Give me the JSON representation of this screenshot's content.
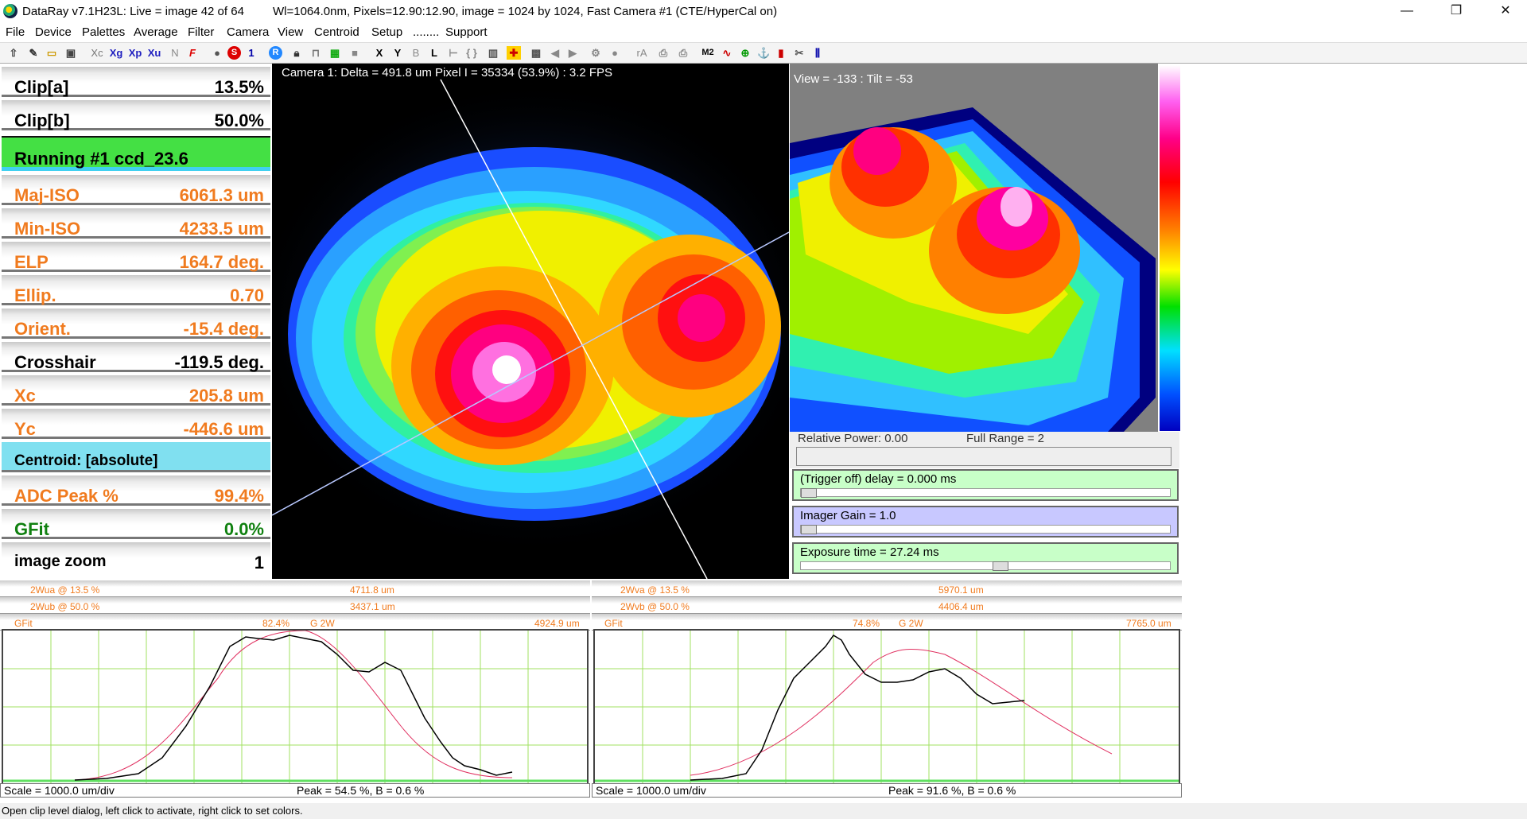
{
  "window": {
    "title": "DataRay v7.1H23L: Live = image 42 of 64",
    "info": "Wl=1064.0nm, Pixels=12.90:12.90, image = 1024 by 1024, Fast   Camera #1  (CTE/HyperCal on)",
    "minimize": "—",
    "restore": "❐",
    "close": "✕"
  },
  "menu": [
    "File",
    "Device",
    "Palettes",
    "Average",
    "Filter",
    "Camera",
    "View",
    "Centroid",
    "Setup",
    "........",
    "Support"
  ],
  "toolbar": {
    "xc": "Xc",
    "xg": "Xg",
    "xp": "Xp",
    "xu": "Xu",
    "n": "N",
    "f": "F",
    "s": "S",
    "one": "1",
    "r": "R",
    "x": "X",
    "y": "Y",
    "b": "B",
    "l": "L",
    "ra": "rA",
    "m2": "M2"
  },
  "results": [
    {
      "label": "Clip[a]",
      "value": "13.5%",
      "style": "black"
    },
    {
      "label": "Clip[b]",
      "value": "50.0%",
      "style": "black"
    },
    {
      "label": "Running #1 ccd_23.6",
      "value": "",
      "style": "run"
    },
    {
      "label": "Maj-ISO",
      "value": "6061.3 um",
      "style": "orange"
    },
    {
      "label": "Min-ISO",
      "value": "4233.5 um",
      "style": "orange"
    },
    {
      "label": "ELP",
      "value": "164.7 deg.",
      "style": "orange"
    },
    {
      "label": "Ellip.",
      "value": "0.70",
      "style": "orange"
    },
    {
      "label": "Orient.",
      "value": "-15.4 deg.",
      "style": "orange"
    },
    {
      "label": "Crosshair",
      "value": "-119.5 deg.",
      "style": "black"
    },
    {
      "label": "Xc",
      "value": "205.8 um",
      "style": "orange"
    },
    {
      "label": "Yc",
      "value": "-446.6 um",
      "style": "orange"
    },
    {
      "label": "Centroid: [absolute]",
      "value": "",
      "style": "cent"
    },
    {
      "label": "ADC Peak %",
      "value": "99.4%",
      "style": "orange"
    },
    {
      "label": "GFit",
      "value": "0.0%",
      "style": "green"
    },
    {
      "label": "image zoom",
      "value": "1",
      "style": "black"
    }
  ],
  "beam": {
    "caption": "Camera 1: Delta = 491.8 um Pixel I = 35334 (53.9%)  :   3.2 FPS"
  },
  "view3d": {
    "caption": "View = -133 : Tilt = -53"
  },
  "power": {
    "relative": "Relative Power: 0.00",
    "range": "Full Range = 2"
  },
  "sliders": [
    {
      "label": "(Trigger off) delay = 0.000 ms",
      "color": "#c8ffc8",
      "thumb": 0.0
    },
    {
      "label": "Imager Gain = 1.0",
      "color": "#c8c8ff",
      "thumb": 0.0
    },
    {
      "label": "Exposure time = 27.24 ms",
      "color": "#c8ffc8",
      "thumb": 0.54
    }
  ],
  "profiles": [
    {
      "h1l": "2Wua @ 13.5 %",
      "h1v": "4711.8 um",
      "h2l": "2Wub @ 50.0 %",
      "h2v": "3437.1 um",
      "gfit": "GFit",
      "gfitv": "82.4%",
      "g2w": "G  2W",
      "g2wv": "4924.9 um",
      "scale": "Scale = 1000.0 um/div",
      "peak": "Peak = 54.5 %,  B = 0.6 %"
    },
    {
      "h1l": "2Wva @ 13.5 %",
      "h1v": "5970.1 um",
      "h2l": "2Wvb @ 50.0 %",
      "h2v": "4406.4 um",
      "gfit": "GFit",
      "gfitv": "74.8%",
      "g2w": "G  2W",
      "g2wv": "7765.0 um",
      "scale": "Scale = 1000.0 um/div",
      "peak": "Peak = 91.6 %,  B = 0.6 %"
    }
  ],
  "status": "Open clip level dialog, left click to activate, right click to set colors."
}
